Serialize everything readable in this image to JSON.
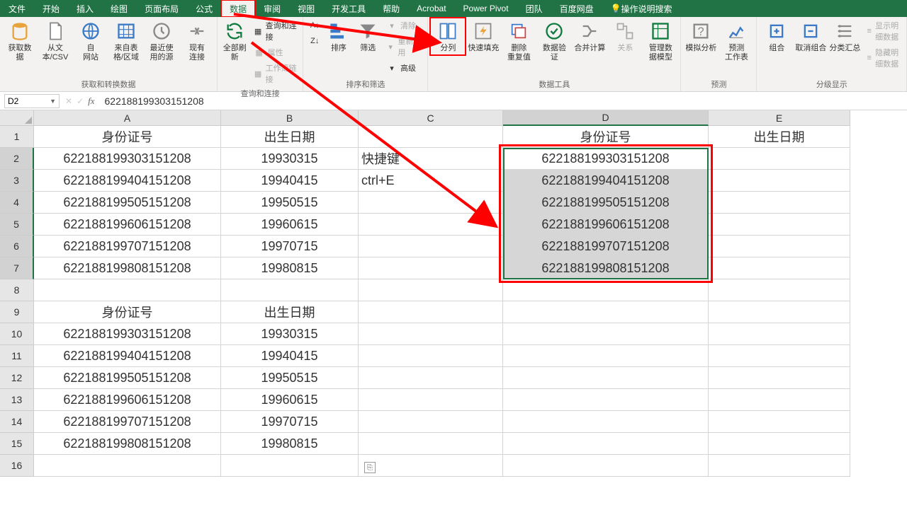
{
  "tabs": [
    "文件",
    "开始",
    "插入",
    "绘图",
    "页面布局",
    "公式",
    "数据",
    "审阅",
    "视图",
    "开发工具",
    "帮助",
    "Acrobat",
    "Power Pivot",
    "团队",
    "百度网盘"
  ],
  "active_tab_index": 6,
  "search_hint": "操作说明搜索",
  "ribbon": {
    "g1": {
      "label": "获取和转换数据",
      "btns": [
        "获取数\n据",
        "从文\n本/CSV",
        "自\n网站",
        "来自表\n格/区域",
        "最近使\n用的源",
        "现有\n连接"
      ]
    },
    "g2": {
      "label": "查询和连接",
      "btn": "全部刷新",
      "items": [
        "查询和连接",
        "属性",
        "工作簿链接"
      ]
    },
    "g3": {
      "label": "排序和筛选",
      "btns": [
        "排序",
        "筛选"
      ],
      "items": [
        "清除",
        "重新应用",
        "高级"
      ]
    },
    "g4": {
      "label": "数据工具",
      "btns": [
        "分列",
        "快速填充",
        "删除\n重复值",
        "数据验\n证",
        "合并计算",
        "关系",
        "管理数\n据模型"
      ]
    },
    "g5": {
      "label": "预测",
      "btns": [
        "模拟分析",
        "预测\n工作表"
      ]
    },
    "g6": {
      "label": "分级显示",
      "btns": [
        "组合",
        "取消组合",
        "分类汇总"
      ],
      "items": [
        "显示明细数据",
        "隐藏明细数据"
      ]
    }
  },
  "namebox": "D2",
  "formula": "622188199303151208",
  "columns": [
    "A",
    "B",
    "C",
    "D",
    "E"
  ],
  "rows": [
    {
      "n": 1,
      "A": "身份证号",
      "B": "出生日期",
      "C": "",
      "D": "身份证号",
      "E": "出生日期"
    },
    {
      "n": 2,
      "A": "622188199303151208",
      "B": "19930315",
      "C": "快捷键",
      "D": "622188199303151208",
      "E": ""
    },
    {
      "n": 3,
      "A": "622188199404151208",
      "B": "19940415",
      "C": "ctrl+E",
      "D": "622188199404151208",
      "E": ""
    },
    {
      "n": 4,
      "A": "622188199505151208",
      "B": "19950515",
      "C": "",
      "D": "622188199505151208",
      "E": ""
    },
    {
      "n": 5,
      "A": "622188199606151208",
      "B": "19960615",
      "C": "",
      "D": "622188199606151208",
      "E": ""
    },
    {
      "n": 6,
      "A": "622188199707151208",
      "B": "19970715",
      "C": "",
      "D": "622188199707151208",
      "E": ""
    },
    {
      "n": 7,
      "A": "622188199808151208",
      "B": "19980815",
      "C": "",
      "D": "622188199808151208",
      "E": ""
    },
    {
      "n": 8,
      "A": "",
      "B": "",
      "C": "",
      "D": "",
      "E": ""
    },
    {
      "n": 9,
      "A": "身份证号",
      "B": "出生日期",
      "C": "",
      "D": "",
      "E": ""
    },
    {
      "n": 10,
      "A": "622188199303151208",
      "B": "19930315",
      "C": "",
      "D": "",
      "E": ""
    },
    {
      "n": 11,
      "A": "622188199404151208",
      "B": "19940415",
      "C": "",
      "D": "",
      "E": ""
    },
    {
      "n": 12,
      "A": "622188199505151208",
      "B": "19950515",
      "C": "",
      "D": "",
      "E": ""
    },
    {
      "n": 13,
      "A": "622188199606151208",
      "B": "19960615",
      "C": "",
      "D": "",
      "E": ""
    },
    {
      "n": 14,
      "A": "622188199707151208",
      "B": "19970715",
      "C": "",
      "D": "",
      "E": ""
    },
    {
      "n": 15,
      "A": "622188199808151208",
      "B": "19980815",
      "C": "",
      "D": "",
      "E": ""
    },
    {
      "n": 16,
      "A": "",
      "B": "",
      "C": "",
      "D": "",
      "E": ""
    }
  ],
  "selected_col": "D",
  "selected_rows": [
    2,
    3,
    4,
    5,
    6,
    7
  ]
}
